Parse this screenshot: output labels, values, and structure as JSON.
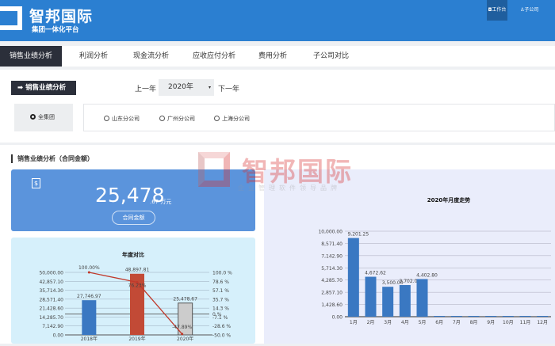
{
  "header": {
    "title": "智邦国际",
    "subtitle": "集团一体化平台",
    "workbench": "工作台",
    "subsidiary": "子公司",
    "color": "#2b7fd1"
  },
  "tabs": [
    {
      "label": "销售业绩分析",
      "active": true
    },
    {
      "label": "利润分析"
    },
    {
      "label": "现金流分析"
    },
    {
      "label": "应收应付分析"
    },
    {
      "label": "费用分析"
    },
    {
      "label": "子公司对比"
    }
  ],
  "filter": {
    "section_button": "销售业绩分析",
    "prev_year": "上一年",
    "year": "2020年",
    "next_year": "下一年",
    "scopes": [
      {
        "label": "全集团",
        "selected": true
      },
      {
        "label": "山东分公司"
      },
      {
        "label": "广州分公司"
      },
      {
        "label": "上海分公司"
      }
    ]
  },
  "section_title": "销售业绩分析（合同金额）",
  "kpi": {
    "value": "25,478",
    "decimal": ".67 万元",
    "button": "合同金额",
    "icon": "dollar-icon"
  },
  "watermark": {
    "text": "智邦国际",
    "sub": "企业管理软件领导品牌"
  },
  "chart_data": [
    {
      "type": "bar+line",
      "title": "年度对比",
      "categories": [
        "2018年",
        "2019年",
        "2020年"
      ],
      "yticks": [
        "50,000.00",
        "42,857.10",
        "35,714.30",
        "28,571.40",
        "21,428.60",
        "14,285.70",
        "7,142.90",
        "0.00"
      ],
      "y2ticks": [
        "100.0 %",
        "78.6 %",
        "57.1 %",
        "35.7 %",
        "14.3 %",
        "0 %",
        "-7.1 %",
        "-28.6 %",
        "-50.0 %"
      ],
      "ylim": [
        0,
        50000
      ],
      "y2lim": [
        -50,
        100
      ],
      "series": [
        {
          "type": "bar",
          "values": [
            27746.97,
            48897.81,
            25478.67
          ],
          "labels": [
            "27,746.97",
            "48,897.81",
            "25,478.67"
          ],
          "colors": [
            "#3a78c2",
            "#c24a36",
            "#cccccc"
          ]
        },
        {
          "type": "line",
          "values": [
            100.0,
            76.23,
            -47.89
          ],
          "labels": [
            "100.00%",
            "76.23%",
            "-47.89%"
          ],
          "color": "#c0392b"
        }
      ]
    },
    {
      "type": "bar",
      "title": "2020年月度走势",
      "categories": [
        "1月",
        "2月",
        "3月",
        "4月",
        "5月",
        "6月",
        "7月",
        "8月",
        "9月",
        "10月",
        "11月",
        "12月"
      ],
      "values": [
        9201.25,
        4672.62,
        3500.0,
        3702.0,
        4402.8,
        0,
        0,
        0,
        0,
        0,
        0,
        0
      ],
      "labels": [
        "9,201.25",
        "4,672.62",
        "3,500.00",
        "3,702.00",
        "4,402.80",
        "",
        "",
        "",
        "",
        "",
        "",
        ""
      ],
      "yticks": [
        "10,000.00",
        "8,571.40",
        "7,142.90",
        "5,714.30",
        "4,285.70",
        "2,857.10",
        "1,428.60",
        "0.00"
      ],
      "ylim": [
        0,
        10000
      ],
      "color": "#3a78c2"
    }
  ]
}
